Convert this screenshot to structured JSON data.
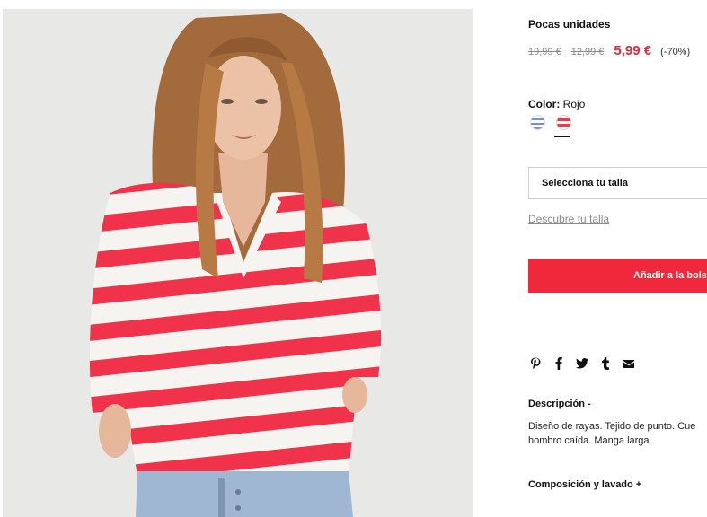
{
  "product": {
    "stock_label": "Pocas unidades",
    "price_original": "19,99 €",
    "price_previous": "12,99 €",
    "price_current": "5,99 €",
    "discount": "(-70%)",
    "color_label": "Color:",
    "color_value": "Rojo",
    "colors": [
      {
        "name": "blue-stripe",
        "hex": "#7d8fc9"
      },
      {
        "name": "red-stripe",
        "hex": "#ee3a47",
        "selected": true
      }
    ],
    "size_select_placeholder": "Selecciona tu talla",
    "size_guide_link": "Descubre tu talla",
    "add_to_bag": "Añadir a la bolsa",
    "share_icons": [
      "pinterest-icon",
      "facebook-icon",
      "twitter-icon",
      "tumblr-icon",
      "email-icon"
    ],
    "description_title": "Descripción -",
    "description_line1": "Diseño de rayas. Tejido de punto. Cue",
    "description_line2": "hombro caída. Manga larga.",
    "composition_title": "Composición y lavado +"
  },
  "colors": {
    "accent": "#f0283c",
    "price": "#e8273a",
    "muted": "#8a8a8a"
  }
}
